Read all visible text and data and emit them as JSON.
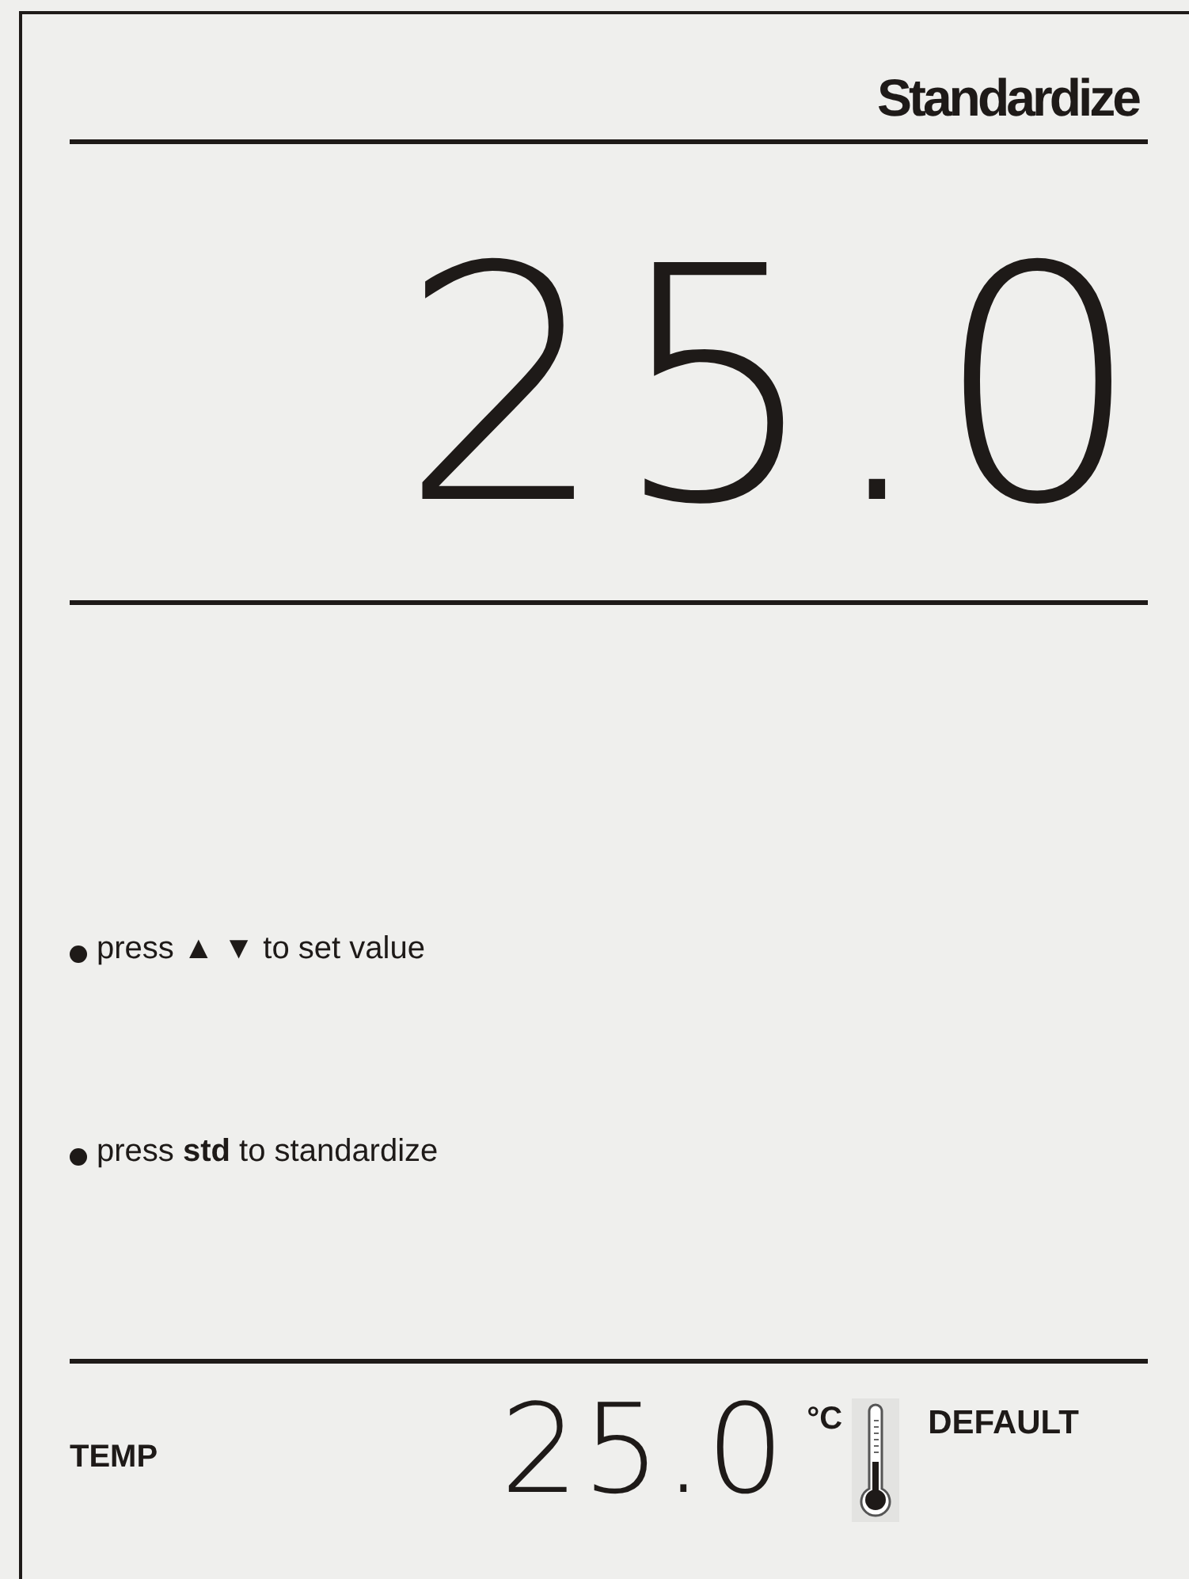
{
  "title": "Standardize",
  "reading": "25.0",
  "instructions": [
    {
      "text": "press ▲  ▼ to set value"
    },
    {
      "text": "press **std** to standardize"
    }
  ],
  "footer": {
    "label": "TEMP",
    "temperature": "25.0",
    "unit": "°C",
    "mode": "DEFAULT"
  }
}
